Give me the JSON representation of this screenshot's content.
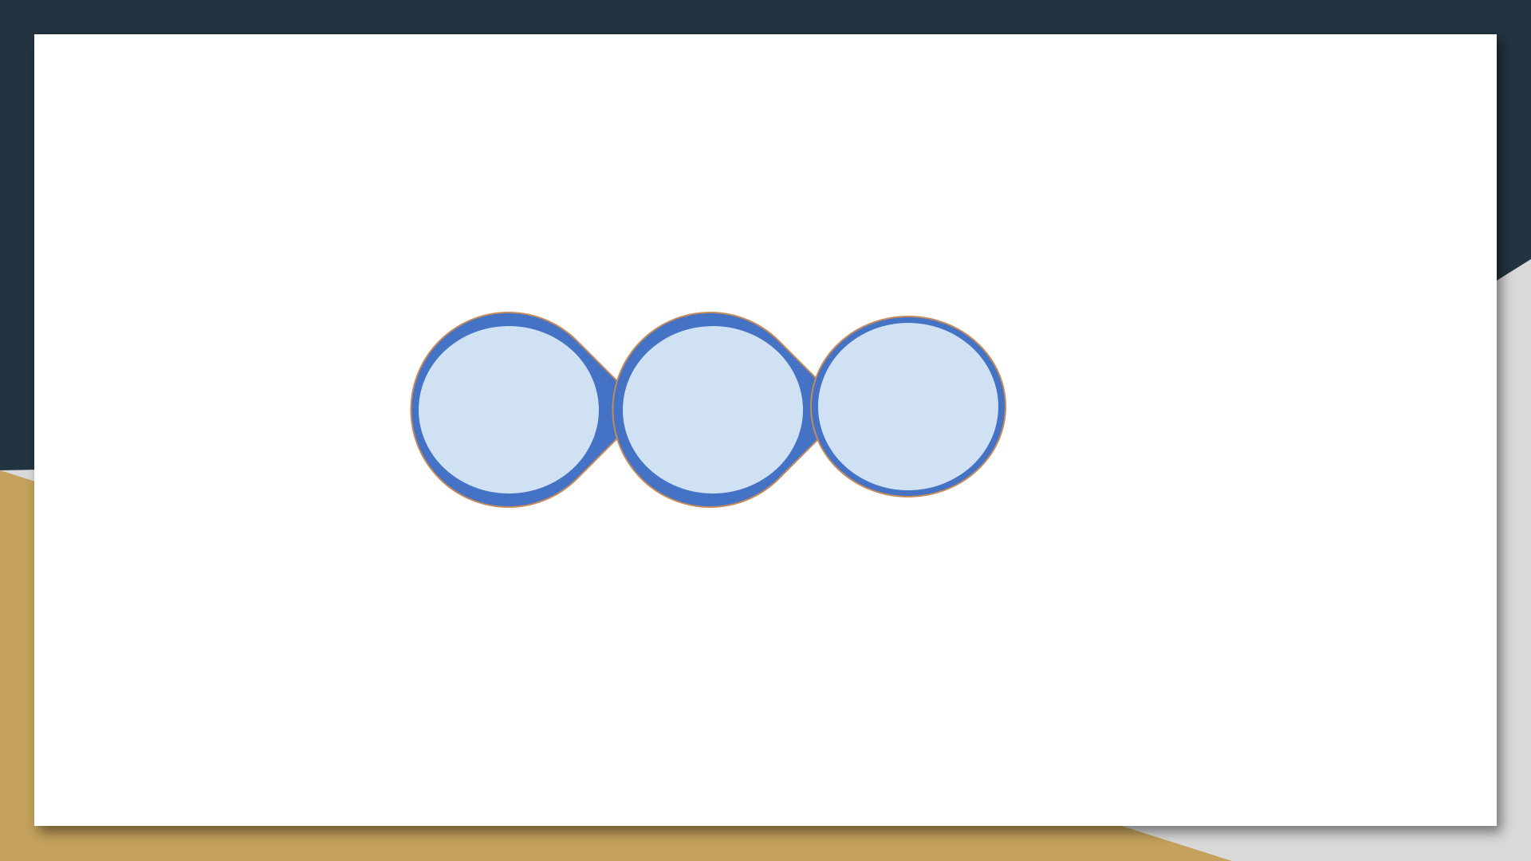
{
  "background": {
    "dark_color": "#22343f",
    "gold_color": "#c4a15c",
    "gray_color": "#d9d9d9"
  },
  "slide": {
    "background_color": "#ffffff"
  },
  "diagram": {
    "shape_count": 3,
    "shapes": [
      {
        "name": "circular-arrow-1"
      },
      {
        "name": "circular-arrow-2"
      },
      {
        "name": "circular-end-circle"
      }
    ],
    "outer_fill": "#4472c4",
    "inner_fill": "#d0e1f3",
    "outline_color": "#c48a5b"
  }
}
